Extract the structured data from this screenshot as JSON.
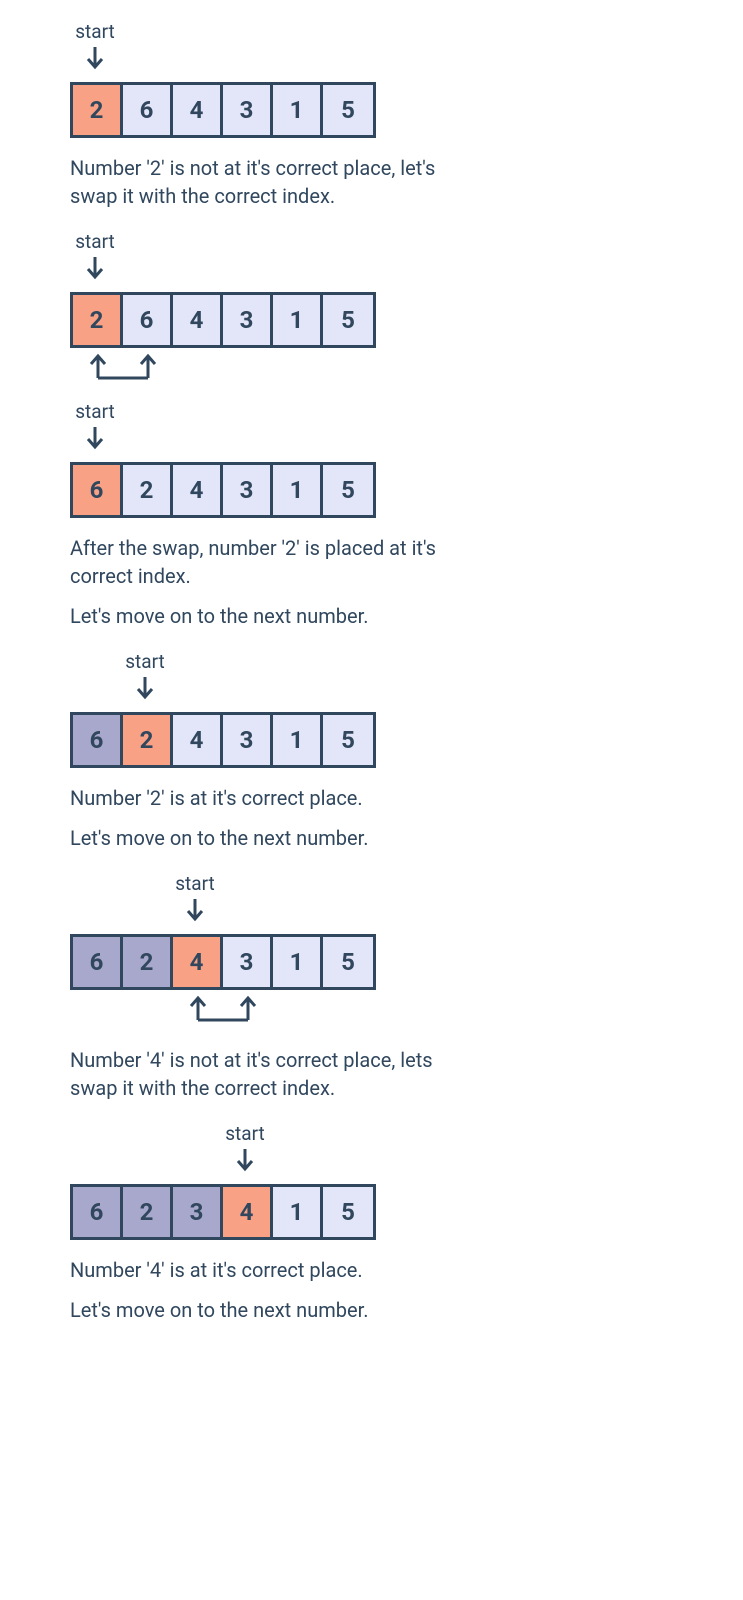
{
  "label": "start",
  "steps": [
    {
      "pointer_index": 0,
      "cells": [
        {
          "v": "2",
          "s": "current"
        },
        {
          "v": "6",
          "s": "normal"
        },
        {
          "v": "4",
          "s": "normal"
        },
        {
          "v": "3",
          "s": "normal"
        },
        {
          "v": "1",
          "s": "normal"
        },
        {
          "v": "5",
          "s": "normal"
        }
      ],
      "swap": null,
      "captions": [
        "Number '2' is not at it's correct place, let's swap it with the correct index."
      ]
    },
    {
      "pointer_index": 0,
      "cells": [
        {
          "v": "2",
          "s": "current"
        },
        {
          "v": "6",
          "s": "normal"
        },
        {
          "v": "4",
          "s": "normal"
        },
        {
          "v": "3",
          "s": "normal"
        },
        {
          "v": "1",
          "s": "normal"
        },
        {
          "v": "5",
          "s": "normal"
        }
      ],
      "swap": {
        "from": 0,
        "to": 1
      },
      "captions": []
    },
    {
      "pointer_index": 0,
      "cells": [
        {
          "v": "6",
          "s": "current"
        },
        {
          "v": "2",
          "s": "normal"
        },
        {
          "v": "4",
          "s": "normal"
        },
        {
          "v": "3",
          "s": "normal"
        },
        {
          "v": "1",
          "s": "normal"
        },
        {
          "v": "5",
          "s": "normal"
        }
      ],
      "swap": null,
      "captions": [
        "After the swap, number '2' is placed at it's correct index.",
        "Let's move on to the next number."
      ]
    },
    {
      "pointer_index": 1,
      "cells": [
        {
          "v": "6",
          "s": "done"
        },
        {
          "v": "2",
          "s": "current"
        },
        {
          "v": "4",
          "s": "normal"
        },
        {
          "v": "3",
          "s": "normal"
        },
        {
          "v": "1",
          "s": "normal"
        },
        {
          "v": "5",
          "s": "normal"
        }
      ],
      "swap": null,
      "captions": [
        "Number '2' is at it's correct place.",
        "Let's move on to the next number."
      ]
    },
    {
      "pointer_index": 2,
      "cells": [
        {
          "v": "6",
          "s": "done"
        },
        {
          "v": "2",
          "s": "done"
        },
        {
          "v": "4",
          "s": "current"
        },
        {
          "v": "3",
          "s": "normal"
        },
        {
          "v": "1",
          "s": "normal"
        },
        {
          "v": "5",
          "s": "normal"
        }
      ],
      "swap": {
        "from": 2,
        "to": 3
      },
      "captions": [
        "Number '4' is not at it's correct place, lets swap it with the correct index."
      ]
    },
    {
      "pointer_index": 3,
      "cells": [
        {
          "v": "6",
          "s": "done"
        },
        {
          "v": "2",
          "s": "done"
        },
        {
          "v": "3",
          "s": "done"
        },
        {
          "v": "4",
          "s": "current"
        },
        {
          "v": "1",
          "s": "normal"
        },
        {
          "v": "5",
          "s": "normal"
        }
      ],
      "swap": null,
      "captions": [
        "Number '4' is at it's correct place.",
        "Let's move on to the next number."
      ]
    }
  ]
}
